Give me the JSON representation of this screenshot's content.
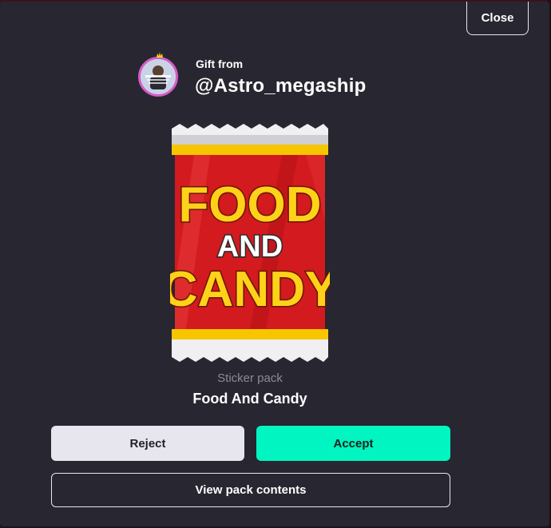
{
  "dialog": {
    "close_label": "Close",
    "gift_label": "Gift from",
    "sender": "@Astro_megaship",
    "item_type": "Sticker pack",
    "item_name": "Food And Candy",
    "pack_art": {
      "line1": "FOOD",
      "line2": "AND",
      "line3": "CANDY",
      "colors": {
        "body": "#d21a1f",
        "band": "#f7c600",
        "text": "#ffd21a",
        "and_text": "#ffffff",
        "foil": "#f2f2f2"
      }
    },
    "reject_label": "Reject",
    "accept_label": "Accept",
    "view_label": "View pack contents"
  },
  "colors": {
    "background": "#282630",
    "accept": "#00f5c0",
    "reject": "#e7e5ee",
    "avatar_ring": "#d65bc8"
  }
}
